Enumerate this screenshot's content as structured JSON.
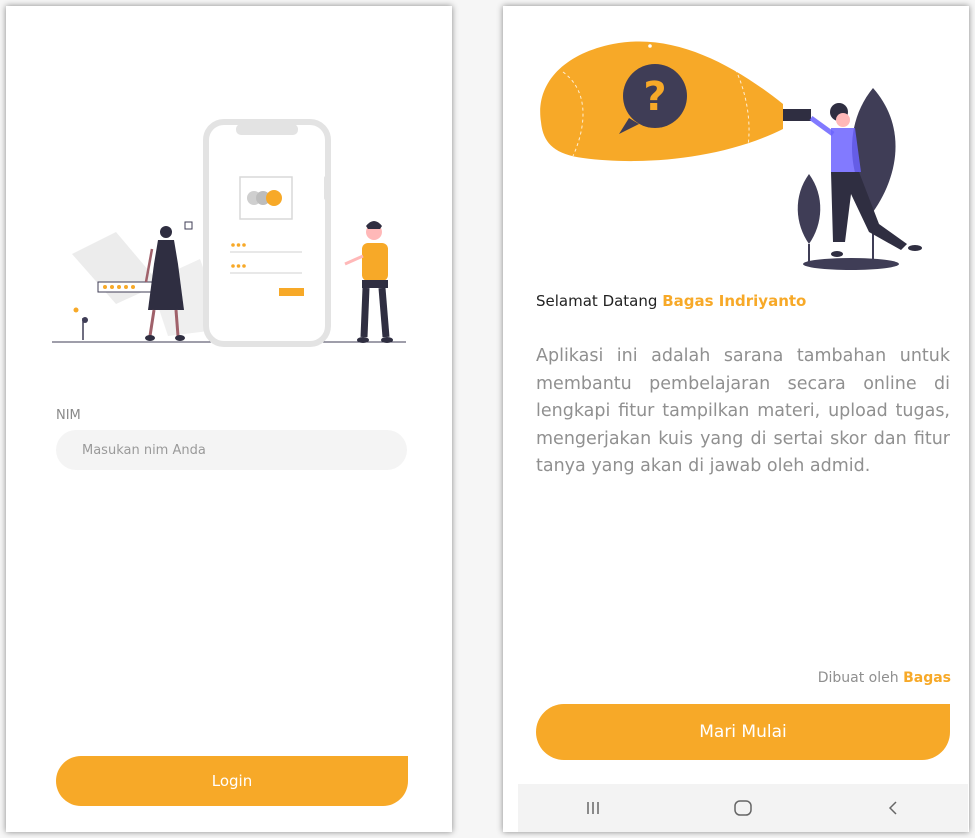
{
  "login": {
    "nim_label": "NIM",
    "nim_placeholder": "Masukan nim Anda",
    "login_label": "Login"
  },
  "welcome": {
    "greeting_prefix": "Selamat Datang",
    "user_name": "Bagas Indriyanto",
    "description": "Aplikasi ini adalah sarana tambahan untuk membantu pembelajaran secara online di lengkapi fitur tampilkan materi, upload tugas, mengerjakan kuis yang di sertai skor dan fitur tanya yang akan di jawab oleh admid.",
    "credit_prefix": "Dibuat oleh",
    "credit_name": "Bagas",
    "start_label": "Mari Mulai"
  },
  "navbar": {
    "recent_icon": "recent-apps-icon",
    "home_icon": "home-icon",
    "back_icon": "back-icon"
  },
  "colors": {
    "accent": "#f7a928",
    "dark": "#3f3d56",
    "muted_text": "#909090"
  }
}
